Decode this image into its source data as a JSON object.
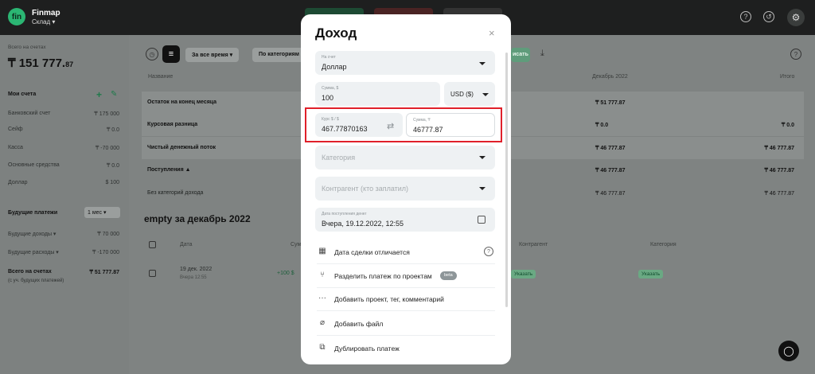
{
  "app": {
    "logo": "fin",
    "name": "Finmap",
    "workspace": "Склад ▾"
  },
  "sidebar": {
    "total_caption": "Всего на счетах",
    "total_main": "₸ 151 777.",
    "total_cents": "87",
    "accounts_title": "Мои счета",
    "accounts": [
      {
        "name": "Банковский счет",
        "value": "₸ 175 000"
      },
      {
        "name": "Сейф",
        "value": "₸ 0.0"
      },
      {
        "name": "Касса",
        "value": "₸ -70 000"
      },
      {
        "name": "Основные средства",
        "value": "₸ 0.0"
      },
      {
        "name": "Доллар",
        "value": "$ 100"
      }
    ],
    "future_title": "Будущие платежи",
    "future_period": "1 мес ▾",
    "future_income_label": "Будущие доходы ▾",
    "future_income_value": "₸ 70 000",
    "future_expense_label": "Будущие расходы ▾",
    "future_expense_value": "₸ -170 000",
    "total_all_label": "Всего на счетах",
    "total_all_sub": "(с уч. будущих платежей)",
    "total_all_value": "₸ 51 777.87"
  },
  "main": {
    "filter_period": "За все время ▾",
    "filter_category": "По категориям",
    "export_btn": "исать",
    "col_name": "Название",
    "col_month": "Декабрь 2022",
    "col_total": "Итого",
    "rows": [
      {
        "label": "Остаток на конец месяца",
        "month": "₸ 51 777.87",
        "total": ""
      },
      {
        "label": "Курсовая разница",
        "month": "₸ 0.0",
        "total": "₸ 0.0"
      },
      {
        "label": "Чистый денежный поток",
        "month": "₸ 46 777.87",
        "total": "₸ 46 777.87"
      },
      {
        "label": "Поступления ▲",
        "month": "₸ 46 777.87",
        "total": "₸ 46 777.87"
      },
      {
        "label": "Без категорий дохода",
        "month": "₸ 46 777.87",
        "total": "₸ 46 777.87"
      }
    ],
    "section_title": "empty за декабрь 2022",
    "th_date": "Дата",
    "th_sum": "Сумм",
    "th_contractor": "Контрагент",
    "th_category": "Категория",
    "tx_date": "19 дек. 2022",
    "tx_sub": "Вчера 12:55",
    "tx_amount": "+100 $",
    "tx_specify1": "Указать",
    "tx_specify2": "Указать"
  },
  "modal": {
    "title": "Доход",
    "close": "×",
    "account_caption": "На счет",
    "account_value": "Доллар",
    "amount_caption": "Сумма, $",
    "amount_value": "100",
    "currency": "USD ($)",
    "rate_caption": "Курс $ / $",
    "rate_value": "467.77870163",
    "converted_caption": "Сумма, ₸",
    "converted_value": "46777.87",
    "category_placeholder": "Категория",
    "contractor_placeholder": "Контрагент (кто заплатил)",
    "date_caption": "Дата поступления денег",
    "date_value": "Вчера, 19.12.2022, 12:55",
    "actions": [
      {
        "label": "Дата сделки отличается"
      },
      {
        "label": "Разделить платеж по проектам",
        "badge": "beta"
      },
      {
        "label": "Добавить проект, тег, комментарий"
      },
      {
        "label": "Добавить файл"
      },
      {
        "label": "Дублировать платеж"
      }
    ]
  },
  "colors": {
    "accent_green": "#2bb673",
    "highlight_red": "#e0202a"
  }
}
